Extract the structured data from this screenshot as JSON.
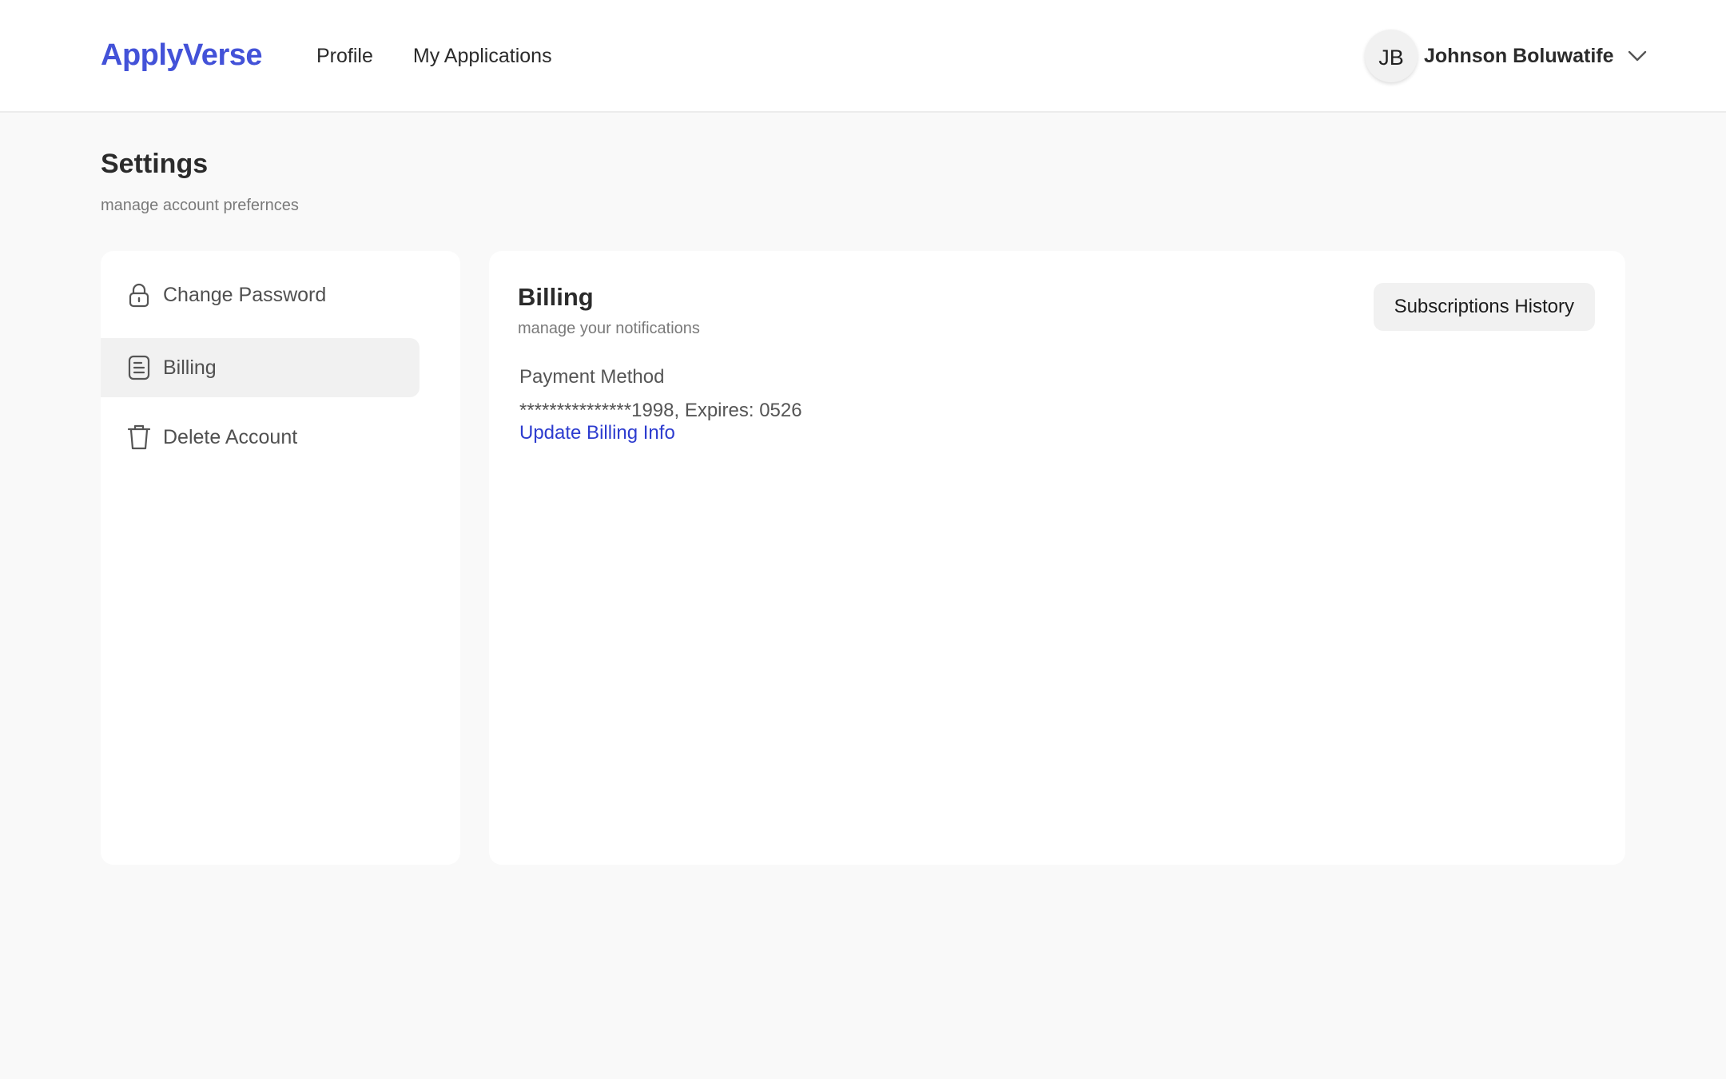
{
  "header": {
    "brand": "ApplyVerse",
    "nav": [
      {
        "label": "Profile"
      },
      {
        "label": "My Applications"
      }
    ],
    "user": {
      "initials": "JB",
      "name": "Johnson Boluwatife",
      "menu_icon": "chevron-down-icon"
    }
  },
  "page": {
    "title": "Settings",
    "subtitle": "manage account prefernces"
  },
  "sidebar": {
    "items": [
      {
        "label": "Change Password",
        "icon": "lock-icon",
        "active": false
      },
      {
        "label": "Billing",
        "icon": "document-icon",
        "active": true
      },
      {
        "label": "Delete Account",
        "icon": "trash-icon",
        "active": false
      }
    ]
  },
  "billing": {
    "title": "Billing",
    "subtitle": "manage your notifications",
    "history_button": "Subscriptions History",
    "payment_method_label": "Payment Method",
    "card_details": "***************1998, Expires: 0526",
    "update_link": "Update Billing Info"
  },
  "colors": {
    "brand": "#4352d8",
    "link": "#2d3ccf",
    "background": "#f9f9f9",
    "active_item": "#f1f1f1"
  }
}
